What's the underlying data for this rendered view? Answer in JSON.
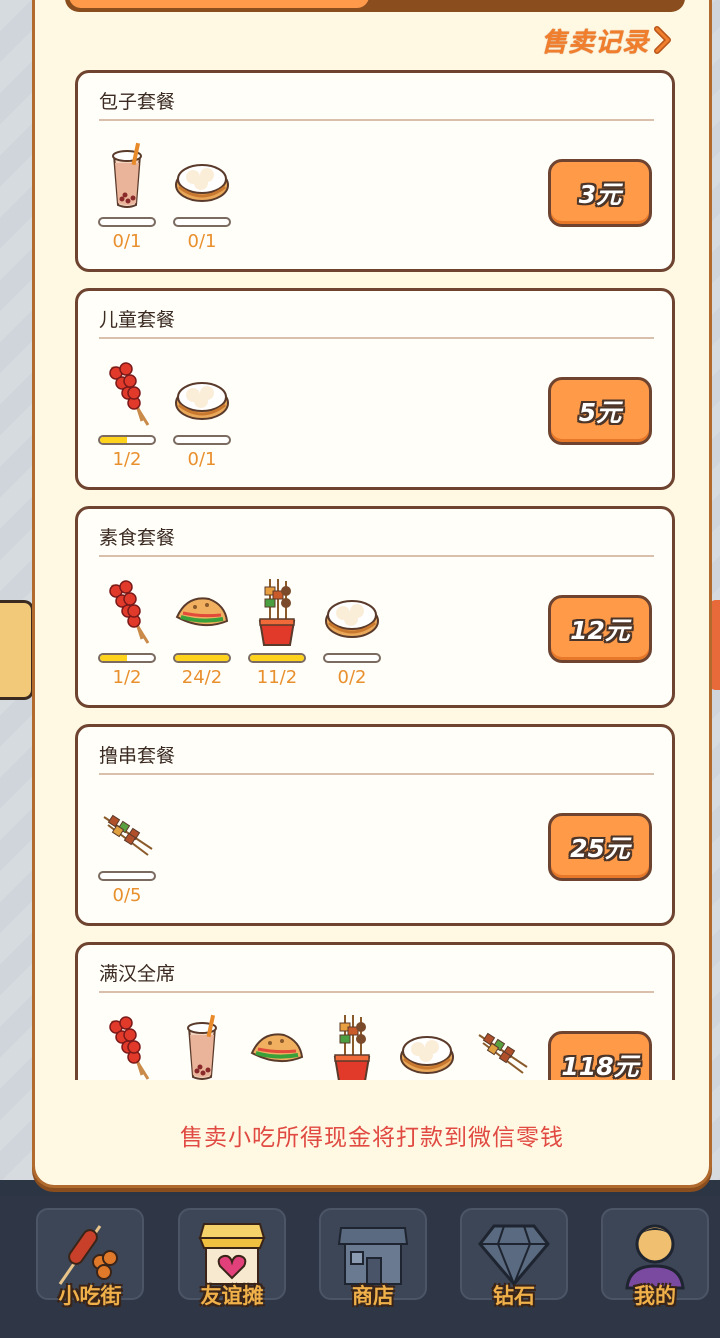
{
  "header": {
    "history_label": "售卖记录"
  },
  "combos": [
    {
      "title": "包子套餐",
      "price": "3元",
      "items": [
        {
          "icon": "milk-tea-icon",
          "progress": 0,
          "count": "0/1"
        },
        {
          "icon": "steamed-bun-icon",
          "progress": 0,
          "count": "0/1"
        }
      ]
    },
    {
      "title": "儿童套餐",
      "price": "5元",
      "items": [
        {
          "icon": "candied-haws-icon",
          "progress": 0.5,
          "count": "1/2"
        },
        {
          "icon": "steamed-bun-icon",
          "progress": 0,
          "count": "0/1"
        }
      ]
    },
    {
      "title": "素食套餐",
      "price": "12元",
      "items": [
        {
          "icon": "candied-haws-icon",
          "progress": 0.5,
          "count": "1/2"
        },
        {
          "icon": "pancake-roll-icon",
          "progress": 1,
          "count": "24/2"
        },
        {
          "icon": "skewer-cup-icon",
          "progress": 1,
          "count": "11/2"
        },
        {
          "icon": "steamed-bun-icon",
          "progress": 0,
          "count": "0/2"
        }
      ]
    },
    {
      "title": "撸串套餐",
      "price": "25元",
      "items": [
        {
          "icon": "kebab-icon",
          "progress": 0,
          "count": "0/5"
        }
      ]
    },
    {
      "title": "满汉全席",
      "price": "118元",
      "items": [
        {
          "icon": "candied-haws-icon",
          "progress": 0,
          "count": ""
        },
        {
          "icon": "milk-tea-icon",
          "progress": 0,
          "count": ""
        },
        {
          "icon": "pancake-roll-icon",
          "progress": 0,
          "count": ""
        },
        {
          "icon": "skewer-cup-icon",
          "progress": 0,
          "count": ""
        },
        {
          "icon": "steamed-bun-icon",
          "progress": 0,
          "count": ""
        },
        {
          "icon": "kebab-icon",
          "progress": 0,
          "count": ""
        }
      ]
    }
  ],
  "notice": "售卖小吃所得现金将打款到微信零钱",
  "nav": [
    {
      "label": "小吃街",
      "icon": "sausage-skewer-icon"
    },
    {
      "label": "友谊摊",
      "icon": "heart-stall-icon"
    },
    {
      "label": "商店",
      "icon": "store-icon"
    },
    {
      "label": "钻石",
      "icon": "diamond-icon"
    },
    {
      "label": "我的",
      "icon": "user-avatar-icon"
    }
  ]
}
